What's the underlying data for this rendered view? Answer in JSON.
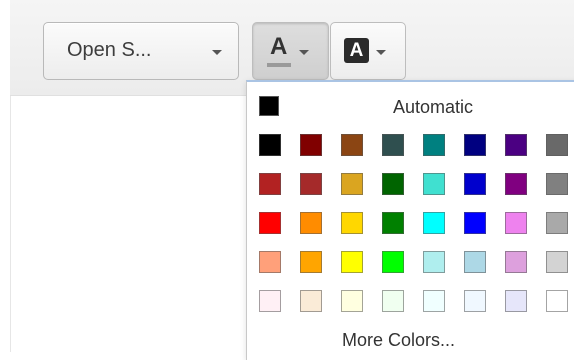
{
  "toolbar": {
    "font_select": {
      "value": "Open S..."
    },
    "text_color_button": {
      "glyph": "A",
      "icon": "text-color-icon"
    },
    "highlight_button": {
      "glyph": "A",
      "icon": "highlight-color-icon"
    }
  },
  "palette": {
    "automatic": {
      "label": "Automatic",
      "color": "#000000"
    },
    "rows": [
      [
        "#000000",
        "#800000",
        "#8b4513",
        "#2f4f4f",
        "#008080",
        "#000080",
        "#4b0082",
        "#696969"
      ],
      [
        "#b22222",
        "#a52a2a",
        "#daa520",
        "#006400",
        "#40e0d0",
        "#0000cd",
        "#800080",
        "#808080"
      ],
      [
        "#ff0000",
        "#ff8c00",
        "#ffd700",
        "#008000",
        "#00ffff",
        "#0000ff",
        "#ee82ee",
        "#a9a9a9"
      ],
      [
        "#ffa07a",
        "#ffa500",
        "#ffff00",
        "#00ff00",
        "#afeeee",
        "#add8e6",
        "#dda0dd",
        "#d3d3d3"
      ],
      [
        "#fff0f5",
        "#faebd7",
        "#ffffe0",
        "#f0fff0",
        "#f0ffff",
        "#f0f8ff",
        "#e6e6fa",
        "#ffffff"
      ]
    ],
    "more_colors_label": "More Colors..."
  }
}
